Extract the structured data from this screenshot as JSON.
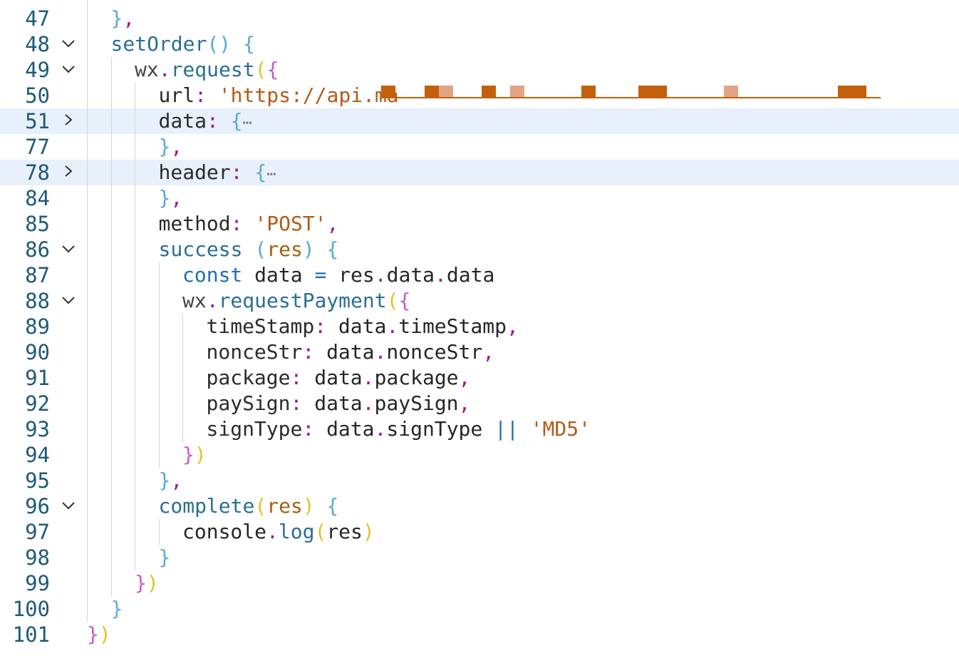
{
  "editor": {
    "lines": [
      {
        "num": "47",
        "fold": "",
        "indent": 1,
        "tokens": [
          {
            "t": "}",
            "c": "b1"
          },
          {
            "t": ",",
            "c": "punc"
          }
        ]
      },
      {
        "num": "48",
        "fold": "expanded",
        "indent": 1,
        "tokens": [
          {
            "t": "setOrder",
            "c": "fn"
          },
          {
            "t": "()",
            "c": "b1"
          },
          {
            "t": " "
          },
          {
            "t": "{",
            "c": "b1"
          }
        ]
      },
      {
        "num": "49",
        "fold": "expanded",
        "indent": 2,
        "tokens": [
          {
            "t": "wx",
            "c": "var"
          },
          {
            "t": ".",
            "c": "punc"
          },
          {
            "t": "request",
            "c": "fn"
          },
          {
            "t": "(",
            "c": "b3"
          },
          {
            "t": "{",
            "c": "b2"
          }
        ]
      },
      {
        "num": "50",
        "fold": "",
        "indent": 3,
        "tokens": [
          {
            "t": "url",
            "c": "prop"
          },
          {
            "t": ":",
            "c": "punc"
          },
          {
            "t": " "
          },
          {
            "t": "'https://api.ma",
            "c": "str"
          }
        ]
      },
      {
        "num": "51",
        "fold": "collapsed",
        "indent": 3,
        "highlight": true,
        "tokens": [
          {
            "t": "data",
            "c": "prop"
          },
          {
            "t": ":",
            "c": "punc"
          },
          {
            "t": " "
          },
          {
            "t": "{",
            "c": "b1"
          },
          {
            "t": "⋯",
            "c": "ell"
          }
        ]
      },
      {
        "num": "77",
        "fold": "",
        "indent": 3,
        "tokens": [
          {
            "t": "}",
            "c": "b1"
          },
          {
            "t": ",",
            "c": "punc"
          }
        ]
      },
      {
        "num": "78",
        "fold": "collapsed",
        "indent": 3,
        "highlight": true,
        "tokens": [
          {
            "t": "header",
            "c": "prop"
          },
          {
            "t": ":",
            "c": "punc"
          },
          {
            "t": " "
          },
          {
            "t": "{",
            "c": "b1"
          },
          {
            "t": "⋯",
            "c": "ell"
          }
        ]
      },
      {
        "num": "84",
        "fold": "",
        "indent": 3,
        "tokens": [
          {
            "t": "}",
            "c": "b1"
          },
          {
            "t": ",",
            "c": "punc"
          }
        ]
      },
      {
        "num": "85",
        "fold": "",
        "indent": 3,
        "tokens": [
          {
            "t": "method",
            "c": "prop"
          },
          {
            "t": ":",
            "c": "punc"
          },
          {
            "t": " "
          },
          {
            "t": "'POST'",
            "c": "str"
          },
          {
            "t": ",",
            "c": "punc"
          }
        ]
      },
      {
        "num": "86",
        "fold": "expanded",
        "indent": 3,
        "tokens": [
          {
            "t": "success",
            "c": "fn"
          },
          {
            "t": " "
          },
          {
            "t": "(",
            "c": "b1"
          },
          {
            "t": "res",
            "c": "par"
          },
          {
            "t": ")",
            "c": "b1"
          },
          {
            "t": " "
          },
          {
            "t": "{",
            "c": "b1"
          }
        ]
      },
      {
        "num": "87",
        "fold": "",
        "indent": 4,
        "tokens": [
          {
            "t": "const",
            "c": "kw"
          },
          {
            "t": " data "
          },
          {
            "t": "=",
            "c": "kw"
          },
          {
            "t": " res"
          },
          {
            "t": ".",
            "c": "punc"
          },
          {
            "t": "data"
          },
          {
            "t": ".",
            "c": "punc"
          },
          {
            "t": "data"
          }
        ]
      },
      {
        "num": "88",
        "fold": "expanded",
        "indent": 4,
        "tokens": [
          {
            "t": "wx",
            "c": "var"
          },
          {
            "t": ".",
            "c": "punc"
          },
          {
            "t": "requestPayment",
            "c": "fn"
          },
          {
            "t": "(",
            "c": "b3"
          },
          {
            "t": "{",
            "c": "b2"
          }
        ]
      },
      {
        "num": "89",
        "fold": "",
        "indent": 5,
        "tokens": [
          {
            "t": "timeStamp",
            "c": "prop"
          },
          {
            "t": ":",
            "c": "punc"
          },
          {
            "t": " data"
          },
          {
            "t": ".",
            "c": "punc"
          },
          {
            "t": "timeStamp"
          },
          {
            "t": ",",
            "c": "punc"
          }
        ]
      },
      {
        "num": "90",
        "fold": "",
        "indent": 5,
        "tokens": [
          {
            "t": "nonceStr",
            "c": "prop"
          },
          {
            "t": ":",
            "c": "punc"
          },
          {
            "t": " data"
          },
          {
            "t": ".",
            "c": "punc"
          },
          {
            "t": "nonceStr"
          },
          {
            "t": ",",
            "c": "punc"
          }
        ]
      },
      {
        "num": "91",
        "fold": "",
        "indent": 5,
        "tokens": [
          {
            "t": "package",
            "c": "prop"
          },
          {
            "t": ":",
            "c": "punc"
          },
          {
            "t": " data"
          },
          {
            "t": ".",
            "c": "punc"
          },
          {
            "t": "package"
          },
          {
            "t": ",",
            "c": "punc"
          }
        ]
      },
      {
        "num": "92",
        "fold": "",
        "indent": 5,
        "tokens": [
          {
            "t": "paySign",
            "c": "prop"
          },
          {
            "t": ":",
            "c": "punc"
          },
          {
            "t": " data"
          },
          {
            "t": ".",
            "c": "punc"
          },
          {
            "t": "paySign"
          },
          {
            "t": ",",
            "c": "punc"
          }
        ]
      },
      {
        "num": "93",
        "fold": "",
        "indent": 5,
        "tokens": [
          {
            "t": "signType",
            "c": "prop"
          },
          {
            "t": ":",
            "c": "punc"
          },
          {
            "t": " data"
          },
          {
            "t": ".",
            "c": "punc"
          },
          {
            "t": "signType"
          },
          {
            "t": " "
          },
          {
            "t": "||",
            "c": "kw"
          },
          {
            "t": " "
          },
          {
            "t": "'MD5'",
            "c": "str"
          }
        ]
      },
      {
        "num": "94",
        "fold": "",
        "indent": 4,
        "tokens": [
          {
            "t": "}",
            "c": "b2"
          },
          {
            "t": ")",
            "c": "b3"
          }
        ]
      },
      {
        "num": "95",
        "fold": "",
        "indent": 3,
        "tokens": [
          {
            "t": "}",
            "c": "b1"
          },
          {
            "t": ",",
            "c": "punc"
          }
        ]
      },
      {
        "num": "96",
        "fold": "expanded",
        "indent": 3,
        "tokens": [
          {
            "t": "complete",
            "c": "fn"
          },
          {
            "t": "(",
            "c": "b3"
          },
          {
            "t": "res",
            "c": "par"
          },
          {
            "t": ")",
            "c": "b3"
          },
          {
            "t": " "
          },
          {
            "t": "{",
            "c": "b1"
          }
        ]
      },
      {
        "num": "97",
        "fold": "",
        "indent": 4,
        "tokens": [
          {
            "t": "console"
          },
          {
            "t": ".",
            "c": "punc"
          },
          {
            "t": "log",
            "c": "fn"
          },
          {
            "t": "(",
            "c": "b3"
          },
          {
            "t": "res"
          },
          {
            "t": ")",
            "c": "b3"
          }
        ]
      },
      {
        "num": "98",
        "fold": "",
        "indent": 3,
        "tokens": [
          {
            "t": "}",
            "c": "b1"
          }
        ]
      },
      {
        "num": "99",
        "fold": "",
        "indent": 2,
        "tokens": [
          {
            "t": "}",
            "c": "b2"
          },
          {
            "t": ")",
            "c": "b3"
          }
        ]
      },
      {
        "num": "100",
        "fold": "",
        "indent": 1,
        "tokens": [
          {
            "t": "}",
            "c": "b1"
          }
        ]
      },
      {
        "num": "101",
        "fold": "",
        "indent": 0,
        "tokens": [
          {
            "t": "}",
            "c": "b2"
          },
          {
            "t": ")",
            "c": "b3"
          }
        ]
      }
    ]
  }
}
